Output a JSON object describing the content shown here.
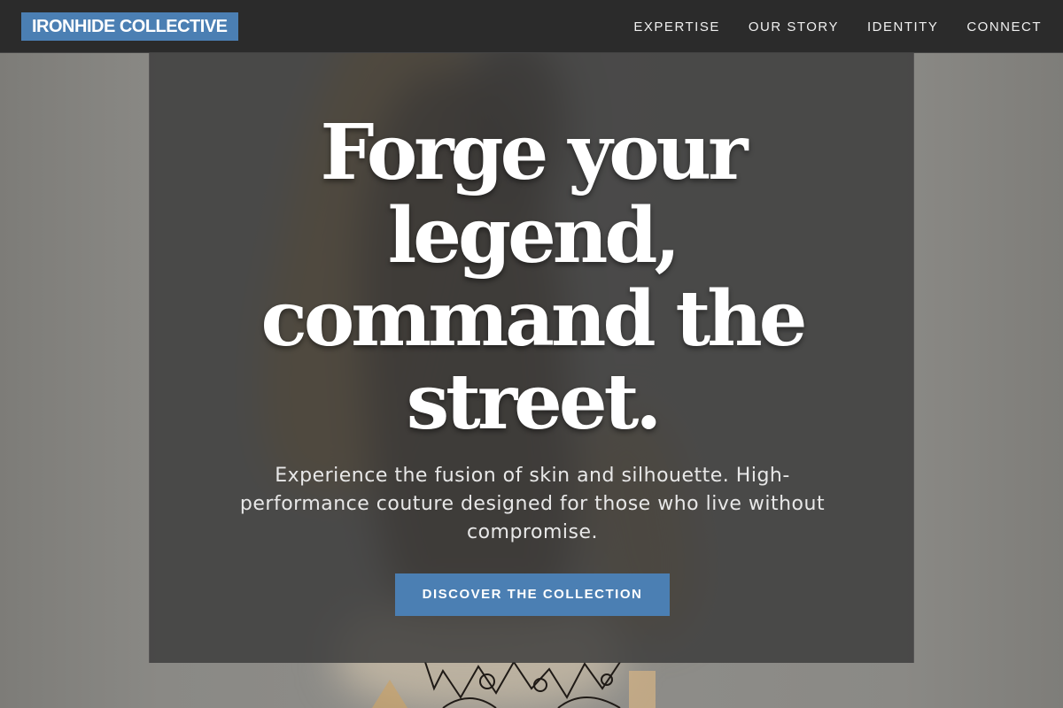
{
  "header": {
    "brand": "IRONHIDE COLLECTIVE",
    "nav": [
      {
        "label": "EXPERTISE"
      },
      {
        "label": "OUR STORY"
      },
      {
        "label": "IDENTITY"
      },
      {
        "label": "CONNECT"
      }
    ]
  },
  "hero": {
    "headline": "Forge your legend, command the street.",
    "subtext": "Experience the fusion of skin and silhouette. High-performance couture designed for those who live without compromise.",
    "cta_label": "DISCOVER THE COLLECTION"
  },
  "colors": {
    "accent": "#4b7fb3",
    "header_bg": "#2b2b2b",
    "panel_bg": "#3a3a3a"
  }
}
